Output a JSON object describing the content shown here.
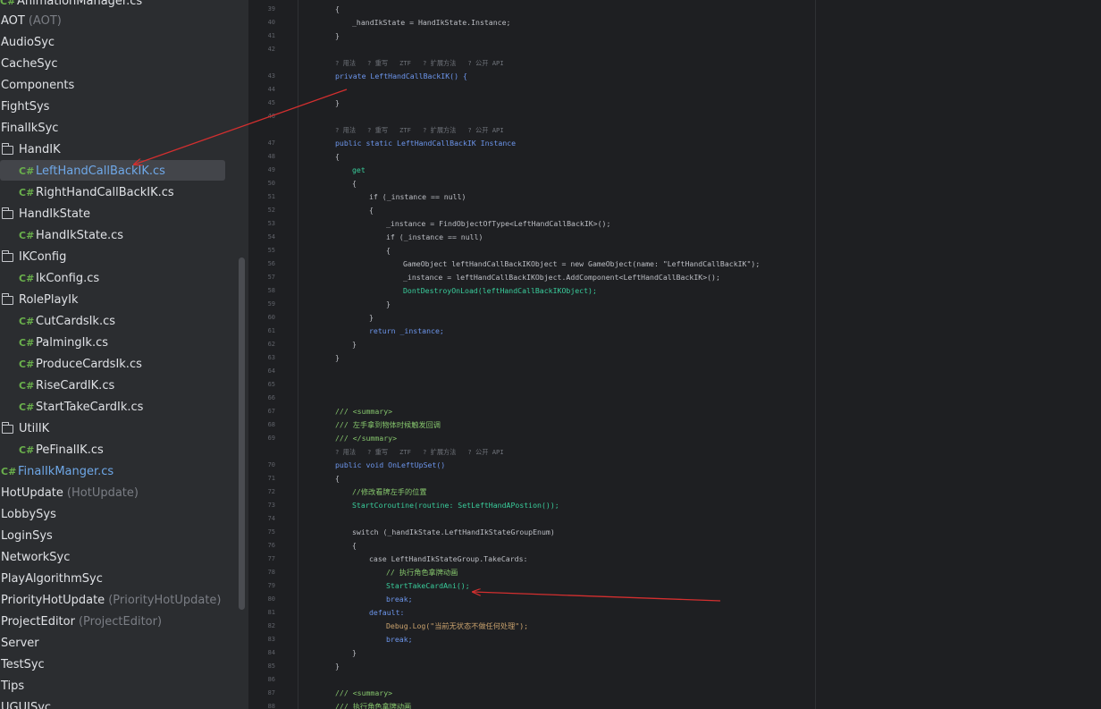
{
  "tree": [
    {
      "type": "file",
      "icon": "C#",
      "label": "AnimationManager.cs",
      "hint": ""
    },
    {
      "type": "folder",
      "label": "AOT",
      "hint": "(AOT)"
    },
    {
      "type": "folder",
      "label": "AudioSyc",
      "hint": ""
    },
    {
      "type": "folder",
      "label": "CacheSyc",
      "hint": ""
    },
    {
      "type": "folder",
      "label": "Components",
      "hint": ""
    },
    {
      "type": "folder",
      "label": "FightSys",
      "hint": ""
    },
    {
      "type": "folder",
      "label": "FinalIkSyc",
      "hint": ""
    },
    {
      "type": "folder",
      "label": "HandIK",
      "hint": ""
    },
    {
      "type": "file",
      "icon": "C#",
      "label": "LeftHandCallBackIK.cs",
      "hint": ""
    },
    {
      "type": "file",
      "icon": "C#",
      "label": "RightHandCallBackIK.cs",
      "hint": ""
    },
    {
      "type": "folder",
      "label": "HandIkState",
      "hint": ""
    },
    {
      "type": "file",
      "icon": "C#",
      "label": "HandIkState.cs",
      "hint": ""
    },
    {
      "type": "folder",
      "label": "IKConfig",
      "hint": ""
    },
    {
      "type": "file",
      "icon": "C#",
      "label": "IkConfig.cs",
      "hint": ""
    },
    {
      "type": "folder",
      "label": "RolePlayIk",
      "hint": ""
    },
    {
      "type": "file",
      "icon": "C#",
      "label": "CutCardsIk.cs",
      "hint": ""
    },
    {
      "type": "file",
      "icon": "C#",
      "label": "PalmingIk.cs",
      "hint": ""
    },
    {
      "type": "file",
      "icon": "C#",
      "label": "ProduceCardsIk.cs",
      "hint": ""
    },
    {
      "type": "file",
      "icon": "C#",
      "label": "RiseCardIK.cs",
      "hint": ""
    },
    {
      "type": "file",
      "icon": "C#",
      "label": "StartTakeCardIk.cs",
      "hint": ""
    },
    {
      "type": "folder",
      "label": "UtilIK",
      "hint": ""
    },
    {
      "type": "file",
      "icon": "C#",
      "label": "PeFinalIK.cs",
      "hint": ""
    },
    {
      "type": "file",
      "icon": "C#",
      "label": "FinalIkManger.cs",
      "hint": ""
    },
    {
      "type": "folder",
      "label": "HotUpdate",
      "hint": "(HotUpdate)"
    },
    {
      "type": "folder",
      "label": "LobbySys",
      "hint": ""
    },
    {
      "type": "folder",
      "label": "LoginSys",
      "hint": ""
    },
    {
      "type": "folder",
      "label": "NetworkSyc",
      "hint": ""
    },
    {
      "type": "folder",
      "label": "PlayAlgorithmSyc",
      "hint": ""
    },
    {
      "type": "folder",
      "label": "PriorityHotUpdate",
      "hint": "(PriorityHotUpdate)"
    },
    {
      "type": "folder",
      "label": "ProjectEditor",
      "hint": "(ProjectEditor)"
    },
    {
      "type": "folder",
      "label": "Server",
      "hint": ""
    },
    {
      "type": "folder",
      "label": "TestSyc",
      "hint": ""
    },
    {
      "type": "folder",
      "label": "Tips",
      "hint": ""
    },
    {
      "type": "folder",
      "label": "UGUISyc",
      "hint": ""
    }
  ],
  "code_lines": [
    {
      "n": "39",
      "text": "{"
    },
    {
      "n": "40",
      "text": "_handIkState = HandIkState.Instance;"
    },
    {
      "n": "41",
      "text": "}"
    },
    {
      "n": "42",
      "text": ""
    },
    {
      "n": "",
      "text": "? 用法   ? 重写   ZTF   ? 扩展方法   ? 公开 API"
    },
    {
      "n": "43",
      "text": "private LeftHandCallBackIK() {"
    },
    {
      "n": "44",
      "text": ""
    },
    {
      "n": "45",
      "text": "}"
    },
    {
      "n": "46",
      "text": ""
    },
    {
      "n": "",
      "text": "? 用法   ? 重写   ZTF   ? 扩展方法   ? 公开 API"
    },
    {
      "n": "47",
      "text": "public static LeftHandCallBackIK Instance"
    },
    {
      "n": "48",
      "text": "{"
    },
    {
      "n": "49",
      "text": "get"
    },
    {
      "n": "50",
      "text": "{"
    },
    {
      "n": "51",
      "text": "if (_instance == null)"
    },
    {
      "n": "52",
      "text": "{"
    },
    {
      "n": "53",
      "text": "_instance = FindObjectOfType<LeftHandCallBackIK>();"
    },
    {
      "n": "54",
      "text": "if (_instance == null)"
    },
    {
      "n": "55",
      "text": "{"
    },
    {
      "n": "56",
      "text": "GameObject leftHandCallBackIKObject = new GameObject(name: \"LeftHandCallBackIK\");"
    },
    {
      "n": "57",
      "text": "_instance = leftHandCallBackIKObject.AddComponent<LeftHandCallBackIK>();"
    },
    {
      "n": "58",
      "text": "DontDestroyOnLoad(leftHandCallBackIKObject);"
    },
    {
      "n": "59",
      "text": "}"
    },
    {
      "n": "60",
      "text": "}"
    },
    {
      "n": "61",
      "text": "return _instance;"
    },
    {
      "n": "62",
      "text": "}"
    },
    {
      "n": "63",
      "text": "}"
    },
    {
      "n": "64",
      "text": ""
    },
    {
      "n": "65",
      "text": ""
    },
    {
      "n": "66",
      "text": ""
    },
    {
      "n": "67",
      "text": "/// <summary>"
    },
    {
      "n": "68",
      "text": "/// 左手拿到物体时候触发回调"
    },
    {
      "n": "69",
      "text": "/// </summary>"
    },
    {
      "n": "",
      "text": "? 用法   ? 重写   ZTF   ? 扩展方法   ? 公开 API"
    },
    {
      "n": "70",
      "text": "public void OnLeftUpSet()"
    },
    {
      "n": "71",
      "text": "{"
    },
    {
      "n": "72",
      "text": "//修改看牌左手的位置"
    },
    {
      "n": "73",
      "text": "StartCoroutine(routine: SetLeftHandAPostion());"
    },
    {
      "n": "74",
      "text": ""
    },
    {
      "n": "75",
      "text": "switch (_handIkState.LeftHandIkStateGroupEnum)"
    },
    {
      "n": "76",
      "text": "{"
    },
    {
      "n": "77",
      "text": "case LeftHandIkStateGroup.TakeCards:"
    },
    {
      "n": "78",
      "text": "// 执行角色拿牌动画"
    },
    {
      "n": "79",
      "text": "StartTakeCardAni();"
    },
    {
      "n": "80",
      "text": "break;"
    },
    {
      "n": "81",
      "text": "default:"
    },
    {
      "n": "82",
      "text": "Debug.Log(\"当前无状态不做任何处理\");"
    },
    {
      "n": "83",
      "text": "break;"
    },
    {
      "n": "84",
      "text": "}"
    },
    {
      "n": "85",
      "text": "}"
    },
    {
      "n": "86",
      "text": ""
    },
    {
      "n": "87",
      "text": "/// <summary>"
    },
    {
      "n": "88",
      "text": "/// 执行角色拿牌动画"
    }
  ],
  "colors": {
    "sidebar_bg": "#2b2d30",
    "editor_bg": "#1e1f22",
    "selection": "#43454a",
    "keyword": "#6c95eb",
    "type": "#c191ff",
    "method": "#39cc9b",
    "string": "#c9a26d",
    "comment": "#85c46c",
    "annotation_arrow": "#d32f2f"
  }
}
